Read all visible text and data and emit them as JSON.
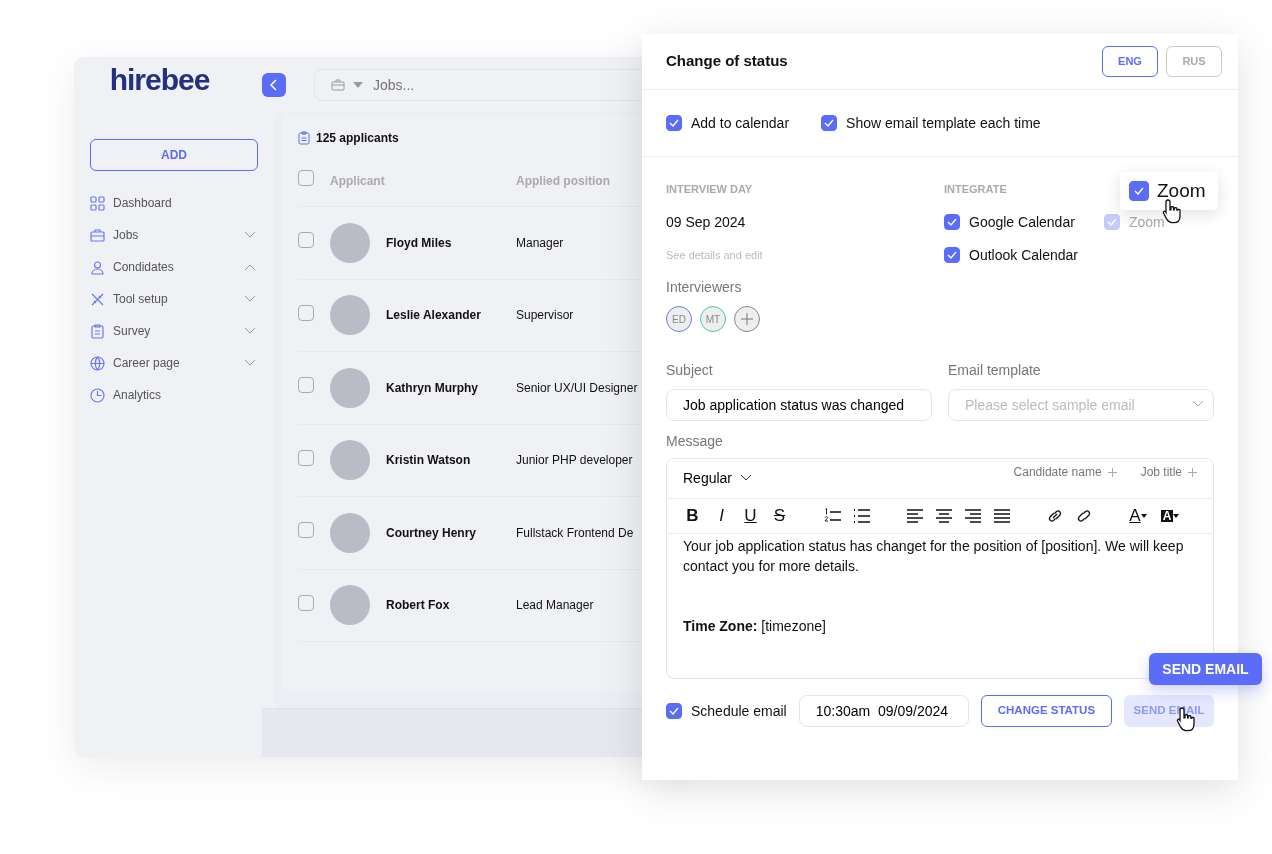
{
  "app": {
    "logo": "hirebee",
    "search": {
      "placeholder": "Jobs..."
    },
    "sidebar": {
      "add_button": "ADD",
      "items": [
        {
          "label": "Dashboard",
          "kind": "link"
        },
        {
          "label": "Jobs",
          "kind": "group",
          "expanded": false
        },
        {
          "label": "Condidates",
          "kind": "group",
          "expanded": true
        },
        {
          "label": "Tool setup",
          "kind": "group",
          "expanded": false
        },
        {
          "label": "Survey",
          "kind": "group",
          "expanded": false
        },
        {
          "label": "Career page",
          "kind": "group",
          "expanded": false
        },
        {
          "label": "Analytics",
          "kind": "link"
        }
      ]
    },
    "applicants": {
      "count": "125 applicants",
      "columns": [
        "Applicant",
        "Applied position"
      ],
      "all_checked": false,
      "rows": [
        {
          "name": "Floyd Miles",
          "position": "Manager",
          "checked": false
        },
        {
          "name": "Leslie Alexander",
          "position": "Supervisor",
          "checked": false
        },
        {
          "name": "Kathryn Murphy",
          "position": "Senior UX/UI Designer",
          "checked": false
        },
        {
          "name": "Kristin Watson",
          "position": "Junior PHP developer",
          "checked": false
        },
        {
          "name": "Courtney Henry",
          "position": "Fullstack Frontend De",
          "checked": false
        },
        {
          "name": "Robert Fox",
          "position": "Lead Manager",
          "checked": false
        }
      ]
    }
  },
  "modal": {
    "title": "Change of status",
    "languages": [
      {
        "label": "ENG",
        "selected": true
      },
      {
        "label": "RUS",
        "selected": false
      }
    ],
    "options": [
      {
        "label": "Add to calendar",
        "checked": true
      },
      {
        "label": "Show email template each time",
        "checked": true
      }
    ],
    "interview_day": {
      "label": "INTERVIEW DAY",
      "date": "09 Sep 2024",
      "link": "See details and edit"
    },
    "interviewers": {
      "label": "Interviewers",
      "people": [
        {
          "initials": "ED",
          "color": "#6b78f5"
        },
        {
          "initials": "MT",
          "color": "#3ccfa6"
        }
      ]
    },
    "integrate": {
      "label": "INTEGRATE",
      "items": [
        {
          "label": "Google Calendar",
          "checked": true,
          "disabled": false
        },
        {
          "label": "Zoom",
          "checked": true,
          "disabled": true
        },
        {
          "label": "Outlook Calendar",
          "checked": true,
          "disabled": false
        }
      ]
    },
    "subject": {
      "label": "Subject",
      "value": "Job application status was changed"
    },
    "email_template": {
      "label": "Email template",
      "placeholder": "Please select sample email"
    },
    "message": {
      "label": "Message",
      "style": "Regular",
      "tokens": [
        "Candidate name",
        "Job title"
      ],
      "toolbar": [
        {
          "kind": "bold",
          "label": "B"
        },
        {
          "kind": "italic",
          "label": "I"
        },
        {
          "kind": "underline",
          "label": "U"
        },
        {
          "kind": "strike",
          "label": "S"
        },
        {
          "kind": "ordered-list"
        },
        {
          "kind": "bullet-list"
        },
        {
          "kind": "align-left"
        },
        {
          "kind": "align-center"
        },
        {
          "kind": "align-right"
        },
        {
          "kind": "justify"
        },
        {
          "kind": "link"
        },
        {
          "kind": "unlink"
        },
        {
          "kind": "text-color",
          "label": "A"
        },
        {
          "kind": "highlight",
          "label": "A"
        }
      ],
      "paragraphs": [
        "Your job application status has changet for the position of [position]. We will keep contact you for more details.",
        "**Time Zone:** [timezone]"
      ]
    },
    "footer": {
      "schedule": {
        "label": "Schedule email",
        "checked": true
      },
      "time": "10:30am  09/09/2024",
      "change_button": "CHANGE STATUS",
      "send_button": {
        "label": "SEND EMAIL",
        "disabled": true
      }
    }
  },
  "callouts": {
    "zoom": {
      "label": "Zoom",
      "checked": true
    },
    "send_button": "SEND EMAIL"
  }
}
